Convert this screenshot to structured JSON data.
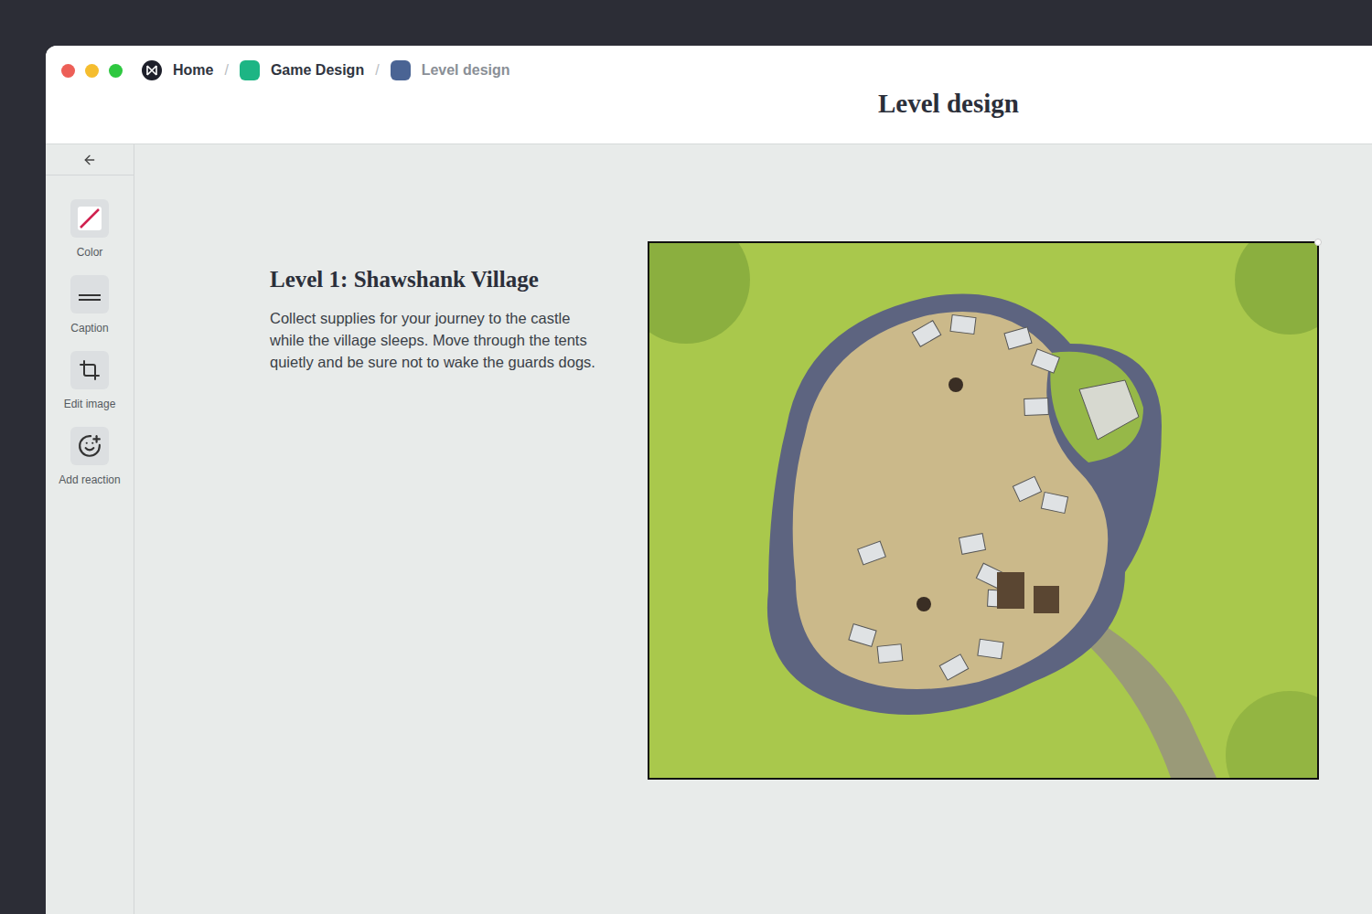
{
  "window": {
    "title": "Level design"
  },
  "breadcrumb": [
    {
      "label": "Home",
      "color": "#1d1f2a",
      "current": false
    },
    {
      "label": "Game Design",
      "color": "#1db584",
      "current": false
    },
    {
      "label": "Level design",
      "color": "#4a6494",
      "current": true
    }
  ],
  "toolbar": {
    "tools": [
      {
        "label": "Color",
        "kind": "color"
      },
      {
        "label": "Caption",
        "kind": "caption"
      },
      {
        "label": "Edit image",
        "kind": "crop"
      },
      {
        "label": "Add reaction",
        "kind": "reaction"
      }
    ]
  },
  "level": {
    "title": "Level 1: Shawshank Village",
    "description": "Collect supplies for your journey to the castle while the village sleeps. Move through the tents quietly and be sure not to wake the guards dogs."
  }
}
